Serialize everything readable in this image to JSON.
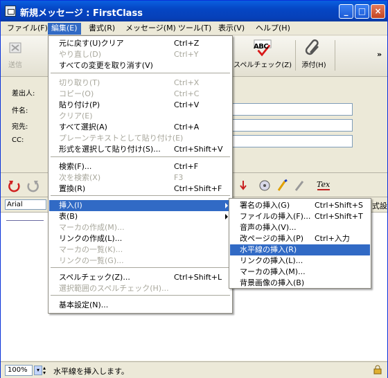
{
  "window": {
    "title": "新規メッセージ : FirstClass"
  },
  "menubar": [
    "ファイル(F)",
    "編集(E)",
    "書式(R)",
    "メッセージ(M)",
    "ツール(T)",
    "表示(V)",
    "ヘルプ(H)"
  ],
  "toolbar": {
    "send": "送信",
    "spellcheck": "スペルチェック(Z)",
    "attach": "添付(H)",
    "abc": "ABC"
  },
  "headers": {
    "from": "差出人:",
    "subject": "件名:",
    "to": "宛先:",
    "cc": "CC:"
  },
  "format": {
    "font": "Arial",
    "right_text": "式設"
  },
  "status": {
    "zoom": "100%",
    "message": "水平線を挿入します。"
  },
  "edit_menu": [
    {
      "label": "元に戻す(U)クリア",
      "shortcut": "Ctrl+Z",
      "enabled": true
    },
    {
      "label": "やり直し(D)",
      "shortcut": "Ctrl+Y",
      "enabled": false
    },
    {
      "label": "すべての変更を取り消す(V)",
      "shortcut": "",
      "enabled": true
    },
    {
      "label": "切り取り(T)",
      "shortcut": "Ctrl+X",
      "enabled": false
    },
    {
      "label": "コピー(O)",
      "shortcut": "Ctrl+C",
      "enabled": false
    },
    {
      "label": "貼り付け(P)",
      "shortcut": "Ctrl+V",
      "enabled": true
    },
    {
      "label": "クリア(E)",
      "shortcut": "",
      "enabled": false
    },
    {
      "label": "すべて選択(A)",
      "shortcut": "Ctrl+A",
      "enabled": true
    },
    {
      "label": "プレーンテキストとして貼り付け(E)",
      "shortcut": "",
      "enabled": false
    },
    {
      "label": "形式を選択して貼り付け(S)...",
      "shortcut": "Ctrl+Shift+V",
      "enabled": true
    },
    {
      "label": "検索(F)...",
      "shortcut": "Ctrl+F",
      "enabled": true
    },
    {
      "label": "次を検索(X)",
      "shortcut": "F3",
      "enabled": false
    },
    {
      "label": "置換(R)",
      "shortcut": "Ctrl+Shift+F",
      "enabled": true
    },
    {
      "label": "挿入(I)",
      "shortcut": "",
      "enabled": true,
      "submenu": true
    },
    {
      "label": "表(B)",
      "shortcut": "",
      "enabled": true,
      "submenu": true
    },
    {
      "label": "マーカの作成(M)...",
      "shortcut": "",
      "enabled": false
    },
    {
      "label": "リンクの作成(L)...",
      "shortcut": "",
      "enabled": true
    },
    {
      "label": "マーカの一覧(K)...",
      "shortcut": "",
      "enabled": false
    },
    {
      "label": "リンクの一覧(G)...",
      "shortcut": "",
      "enabled": false
    },
    {
      "label": "スペルチェック(Z)...",
      "shortcut": "Ctrl+Shift+L",
      "enabled": true
    },
    {
      "label": "選択範囲のスペルチェック(H)...",
      "shortcut": "",
      "enabled": false
    },
    {
      "label": "基本設定(N)...",
      "shortcut": "",
      "enabled": true
    }
  ],
  "insert_submenu": [
    {
      "label": "署名の挿入(G)",
      "shortcut": "Ctrl+Shift+S"
    },
    {
      "label": "ファイルの挿入(F)...",
      "shortcut": "Ctrl+Shift+T"
    },
    {
      "label": "音声の挿入(V)...",
      "shortcut": ""
    },
    {
      "label": "改ページの挿入(P)",
      "shortcut": "Ctrl+入力"
    },
    {
      "label": "水平線の挿入(R)",
      "shortcut": ""
    },
    {
      "label": "リンクの挿入(L)...",
      "shortcut": ""
    },
    {
      "label": "マーカの挿入(M)...",
      "shortcut": ""
    },
    {
      "label": "背景画像の挿入(B)",
      "shortcut": ""
    }
  ]
}
